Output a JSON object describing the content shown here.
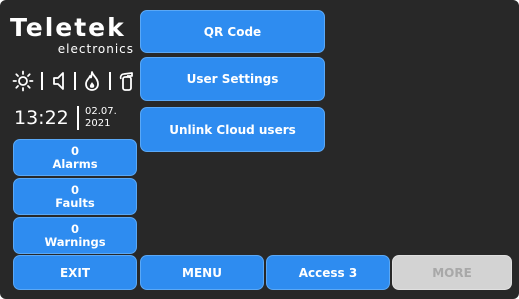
{
  "logo": {
    "brand": "Teletek",
    "sub": "electronics"
  },
  "status_icons": [
    "sun-icon",
    "speaker-icon",
    "flame-icon",
    "fire-extinguisher-icon"
  ],
  "clock": {
    "time": "13:22",
    "date_line1": "02.07.",
    "date_line2": "2021"
  },
  "counters": {
    "alarms": {
      "count": "0",
      "label": "Alarms"
    },
    "faults": {
      "count": "0",
      "label": "Faults"
    },
    "warnings": {
      "count": "0",
      "label": "Warnings"
    }
  },
  "menu": {
    "qr_code": "QR Code",
    "user_settings": "User Settings",
    "unlink_cloud": "Unlink Cloud users"
  },
  "bottom_bar": {
    "exit": "EXIT",
    "menu": "MENU",
    "access": "Access 3",
    "more": "MORE"
  },
  "colors": {
    "background": "#282828",
    "button": "#2e8cf0",
    "button_disabled": "#d3d3d3",
    "text": "#ffffff"
  }
}
